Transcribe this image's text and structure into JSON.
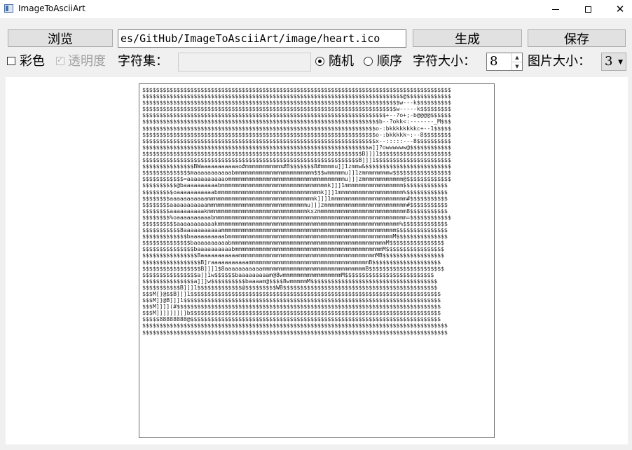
{
  "window": {
    "title": "ImageToAsciiArt",
    "minimize_icon": "minimize-icon",
    "maximize_icon": "maximize-icon",
    "close_icon": "close-icon",
    "close_glyph": "✕"
  },
  "toolbar": {
    "browse_label": "浏览",
    "path_value": "es/GitHub/ImageToAsciiArt/image/heart.ico",
    "generate_label": "生成",
    "save_label": "保存"
  },
  "options": {
    "color_label": "彩色",
    "color_checked": false,
    "transparency_label": "透明度",
    "transparency_checked": true,
    "transparency_enabled": false,
    "charset_label": "字符集：",
    "charset_value": "",
    "random_label": "随机",
    "random_selected": true,
    "sequential_label": "顺序",
    "sequential_selected": false,
    "char_size_label": "字符大小：",
    "char_size_value": "8",
    "image_size_label": "图片大小：",
    "image_size_value": "3"
  },
  "ascii_art": [
    "$$$$$$$$$$$$$$$$$$$$$$$$$$$$$$$$$$$$$$$$$$$$$$$$$$$$$$$$$$$$$$$$$$$$$$$$$$$$$$$$$$$$$$$$$$",
    "$$$$$$$$$$$$$$$$$$$$$$$$$$$$$$$$$$$$$$$$$$$$$$$$$$$$$$$$$$$$$$$$$$$$$$$$$$$$@$$$$$$$$$$$$$",
    "$$$$$$$$$$$$$$$$$$$$$$$$$$$$$$$$$$$$$$$$$$$$$$$$$$$$$$$$$$$$$$$$$$$$$$$$$$$w---k$$$$$$$$$$",
    "$$$$$$$$$$$$$$$$$$$$$$$$$$$$$$$$$$$$$$$$$$$$$$$$$$$$$$$$$$$$$$$$$$$$$$$$$$w-----k$$$$$$$$$",
    "$$$$$$$$$$$$$$$$$$$$$$$$$$$$$$$$$$$$$$$$$$$$$$$$$$$$$$$$$$$$$$$$$$$$$$$+--?o+;-b@@@@$$$$$$",
    "$$$$$$$$$$$$$$$$$$$$$$$$$$$$$$$$$$$$$$$$$$$$$$$$$$$$$$$$$$$$$$$$$$$$$b--?okk<:-------_M$$$",
    "$$$$$$$$$$$$$$$$$$$$$$$$$$$$$$$$$$$$$$$$$$$$$$$$$$$$$$$$$$$$$$$$$$$$o-:bkkkkkkkkc+--1$$$$$",
    "$$$$$$$$$$$$$$$$$$$$$$$$$$$$$$$$$$$$$$$$$$$$$$$$$$$$$$$$$$$$$$$$$$$$o-:bkkkkk~:--8$$$$$$$$",
    "$$$$$$$$$$$$$$$$$$$$$$$$$$$$$$$$$$$$$$$$$$$$$$$$$$$$$$$$$$$$$$$$$$$$x--:::::---8$$$$$$$$$$",
    "$$$$$$$$$$$$$$$$$$$$$$$$$$$$$$$$$$$$$$$$$$$$$$$$$$$$$$$$$$$$$$$$$$a]]?owwwwww@$$$$$$$$$$$$",
    "$$$$$$$$$$$$$$$$$$$$$$$$$$$$$$$$$$$$$$$$$$$$$$$$$$$$$$$$$$$$$$$$B]]]1$$$$$$$$$$$$$$$$$$$$$",
    "$$$$$$$$$$$$$$$$$$$$$$$$$$$$$$$$$$$$$$$$$$$$$$$$$$$$$$$$$$$$$$$B]]]1$$$$$$$$$$$$$$$$$$$$$$",
    "$$$$$$$$$$$$$$$BWaaaaaaaaaaao#mmmmmmmmmmm#8$$$$$$$8#mmmmu]]1zmmw&$$$$$$$$$$$$$$$$$$$$$$$$$",
    "$$$$$$$$$$$$$$maaaaaaaaaaabmmmmmmmmmmmmmmmmmmmmmmm$$$wmmmmmu]]1zmmmmmmmmw$$$$$$$$$$$$$$$$$",
    "$$$$$$$$$$$$=aaaaaaaaaaaommmmmmmmmmmmmmmmmmmmmmmmmmmmmmmmmmu]]]zmmmmmmmmmmmm@$$$$$$$$$$$$$",
    "$$$$$$$$$$@baaaaaaaaaabmmmmmmmmmmmmmmmmmmmmmmmmmmmmmmmk]]]1mmmmmmmmmmmmmmmmm$$$$$$$$$$$$$",
    "$$$$$$$$$oaaaaaaaaaaabmmmmmmmmmmmmmmmmmmmmmmmmmmmmmmk]]]1mmmmmmmmmmmmmmmmmmm%$$$$$$$$$$$$",
    "$$$$$$$$aaaaaaaaaaammmmmmmmmmmmmmmmmmmmmmmmmmmmmmmk]]]1mmmmmmmmmmmmmmmmmmmmmm#$$$$$$$$$$$",
    "$$$$$$$$aaaaaaaaaaammmmmmmmmmmmmmmmmmmmmmmmmmmmmu]]]zmmmmmmmmmmmmmmmmmmmmmmmm#$$$$$$$$$$$",
    "$$$$$$$$aaaaaaaaaakmmmmmmmmmmmmmmmmmmmmmmmmmmmmmkxzmmmmmmmmmmmmmmmmmmmmmmmmmm8$$$$$$$$$$$",
    "$$$$$$$$%oaaaaaaaaaabmmmmmmmmmmmmmmmmmmmmmmmmmmmmmmmmmmmmmmmmmmmmmmmmmmmmmmmm=$$$$$$$$$$$$",
    "$$$$$$$$$$aaaaaaaaaaakmmmmmmmmmmmmmmmmmmmmmmmmmmmmmmmmmmmmmmmmmmmmmmmmmmmmm%$$$$$$$$$$$$$",
    "$$$$$$$$$$$8aaaaaaaaaaammmmmmmmmmmmmmmmmmmmmmmmmmmmmmmmmmmmmmmmmmmmmmmmmmm$$$$$$$$$$$$$$$",
    "$$$$$$$$$$$$$baaaaaaaaaabmmmmmmmmmmmmmmmmmmmmmmmmmmmmmmmmmmmmmmmmmmmmmmmmM$$$$$$$$$$$$$$$",
    "$$$$$$$$$$$$$$baaaaaaaaaabmmmmmmmmmmmmmmmmmmmmmmmmmmmmmmmmmmmmmmmmmmmmmM$$$$$$$$$$$$$$$$",
    "$$$$$$$$$$$$$$$baaaaaaaaaabmmmmmmmmmmmmmmmmmmmmmmmmmmmmmmmmmmmmmmmmmmmM$$$$$$$$$$$$$$$$$",
    "$$$$$$$$$$$$$$$$8aaaaaaaaaaammmmmmmmmmmmmmmmmmmmmmmmmmmmmmmmmmmmmmmmMB$$$$$$$$$$$$$$$$$$",
    "$$$$$$$$$$$$$$$$$B]raaaaaaaaaaammmmmmmmmmmmmmmmmmmmmmmmmmmmmmmmmmmB$$$$$$$$$$$$$$$$$$$$",
    "$$$$$$$$$$$$$$$$$B]]]1$8aaaaaaaaaaammmmmmmmmmmmmmmmmmmmmmmmmmmmmmB$$$$$$$$$$$$$$$$$$$$$$",
    "$$$$$$$$$$$$$$$$a]]1w$$$$$$baaaaaaaaam@8wmmmmmmmmmmmmmmmmmM$$$$$$$$$$$$$$$$$$$$$$$$$$",
    "$$$$$$$$$$$$$$$a]]]w$$$$$$$$$$baaaam@$$$$8wmmmmmM$$$$$$$$$$$$$$$$$$$$$$$$$$$$$$$$$$$$$",
    "$$$$$$$$$$$B]]]1$$$$$$$$$$$$$@$$$$$$$$$WB$$$$$$$$$$$$$$$$$$$$$$$$$$$$$$$$$$$$$$$$$$$$$",
    "$$$M[]@$$B]]]1$$$$$$$$$$$$$$$$$$$$$$$$$$$$$$$$$$$$$$$$$$$$$$$$$$$$$$$$$$$$$$$$$$$$$$$$$",
    "$$$M]]@B]]]1$$$$$$$$$$$$$$$$$$$$$$$$$$$$$$$$$$$$$$$$$$$$$$$$$$$$$$$$$$$$$$$$$$$$$$$$$$$",
    "$$$M]]]](#$$$$$$$$$$$$$$$$$$$$$$$$$$$$$$$$$$$$$$$$$$$$$$$$$$$$$$$$$$$$$$$$$$$$$$$$$$$$$",
    "$$$M]]]]]]]]]b$$$$$$$$$$$$$$$$$$$$$$$$$$$$$$$$$$$$$$$$$$$$$$$$$$$$$$$$$$$$$$$$$$$$$$$$$",
    "$$$$$88888888@$$$$$$$$$$$$$$$$$$$$$$$$$$$$$$$$$$$$$$$$$$$$$$$$$$$$$$$$$$$$$$$$$$$$$$$$$",
    "$$$$$$$$$$$$$$$$$$$$$$$$$$$$$$$$$$$$$$$$$$$$$$$$$$$$$$$$$$$$$$$$$$$$$$$$$$$$$$$$$$$$$$$$$",
    "$$$$$$$$$$$$$$$$$$$$$$$$$$$$$$$$$$$$$$$$$$$$$$$$$$$$$$$$$$$$$$$$$$$$$$$$$$$$$$$$$$$$$$$$$"
  ]
}
